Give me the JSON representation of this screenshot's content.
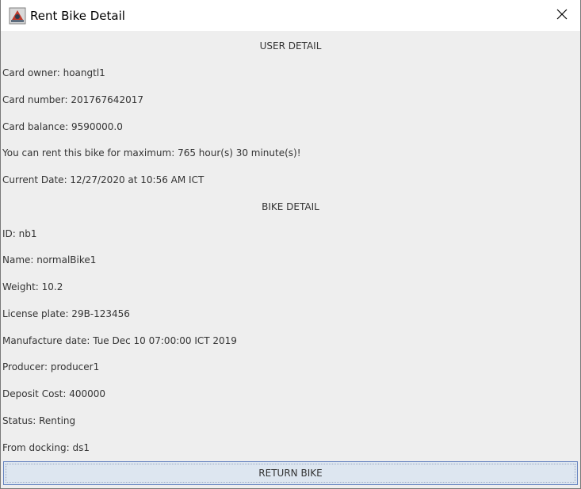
{
  "window": {
    "title": "Rent Bike Detail",
    "icon": "java-app-icon",
    "close_icon": "close-icon"
  },
  "user_detail": {
    "heading": "USER DETAIL",
    "card_owner": "Card owner: hoangtl1",
    "card_number": "Card number: 201767642017",
    "card_balance": "Card balance: 9590000.0",
    "max_rent": "You can rent this bike for maximum: 765 hour(s) 30 minute(s)!",
    "current_date": "Current Date: 12/27/2020 at 10:56 AM ICT"
  },
  "bike_detail": {
    "heading": "BIKE DETAIL",
    "id": "ID: nb1",
    "name": "Name: normalBike1",
    "weight": "Weight: 10.2",
    "license_plate": "License plate: 29B-123456",
    "manufacture_date": "Manufacture date: Tue Dec 10 07:00:00 ICT 2019",
    "producer": "Producer: producer1",
    "deposit_cost": "Deposit Cost: 400000",
    "status": "Status: Renting",
    "from_docking": "From docking: ds1"
  },
  "actions": {
    "return_label": "RETURN BIKE"
  },
  "colors": {
    "content_bg": "#eeeeee",
    "button_bg": "#dde6f0",
    "button_border": "#6382bf"
  }
}
